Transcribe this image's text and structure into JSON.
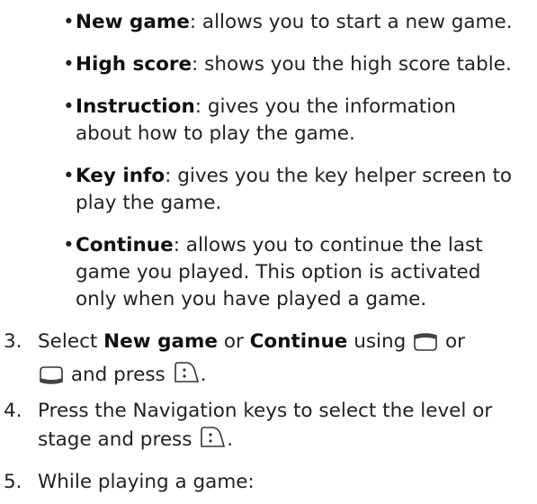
{
  "bullets": [
    {
      "term": "New game",
      "text": ": allows you to start a new game."
    },
    {
      "term": "High score",
      "text": ": shows you the high score table."
    },
    {
      "term": "Instruction",
      "text": ": gives you the information",
      "line2": "about how to play the game."
    },
    {
      "term": "Key info",
      "text": ": gives you the key helper screen to",
      "line2": "play the game."
    },
    {
      "term": "Continue",
      "text": ": allows you to continue the last",
      "line2": "game you played. This option is activated",
      "line3": "only when you have played a game."
    }
  ],
  "steps": [
    {
      "num": "3.",
      "pre": "Select ",
      "bold1": "New game",
      "mid": " or ",
      "bold2": "Continue",
      "post": " using",
      "or": " or",
      "line2_post": " and press",
      "end": "."
    },
    {
      "num": "4.",
      "line1": "Press the Navigation keys to select the level or",
      "line2": "stage and press",
      "end": "."
    },
    {
      "num": "5.",
      "line1": "While playing a game:"
    }
  ],
  "icons": {
    "up_key": "up-navigation-key-icon",
    "down_key": "down-navigation-key-icon",
    "ok_key": "confirm-key-icon"
  },
  "colors": {
    "text": "#222222",
    "icon_stroke": "#333333"
  }
}
